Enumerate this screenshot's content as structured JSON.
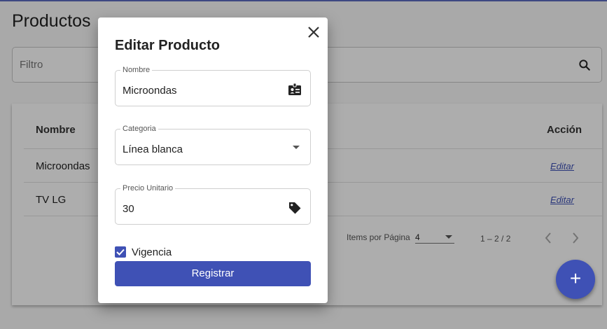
{
  "page": {
    "title": "Productos",
    "filter_placeholder": "Filtro"
  },
  "table": {
    "columns": [
      "Nombre",
      "Acción"
    ],
    "rows": [
      {
        "nombre": "Microondas",
        "accion": "Editar"
      },
      {
        "nombre": "TV LG",
        "accion": "Editar"
      }
    ],
    "paginator": {
      "items_label": "Items por Página",
      "page_size": "4",
      "range": "1 – 2 / 2"
    }
  },
  "fab": {
    "icon": "plus-icon",
    "symbol": "+"
  },
  "dialog": {
    "title": "Editar Producto",
    "fields": {
      "nombre": {
        "label": "Nombre",
        "value": "Microondas",
        "icon": "id-card-icon"
      },
      "categoria": {
        "label": "Categoria",
        "value": "Línea blanca",
        "icon": "dropdown-arrow-icon"
      },
      "precio": {
        "label": "Precio Unitario",
        "value": "30",
        "icon": "tag-icon"
      }
    },
    "vigencia": {
      "label": "Vigencia",
      "checked": true
    },
    "submit_label": "Registrar"
  },
  "colors": {
    "primary": "#3f51b5",
    "backdrop": "rgba(0,0,0,0.32)"
  }
}
